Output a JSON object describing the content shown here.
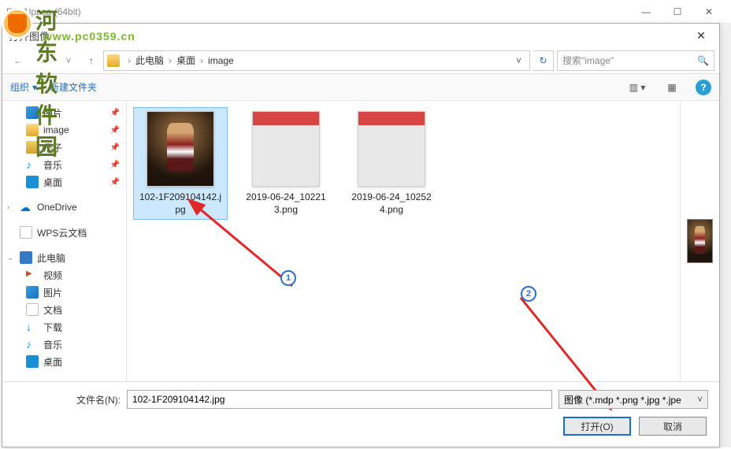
{
  "app": {
    "title": "FireAlpaca (64bit)"
  },
  "watermark": {
    "text1": "河东软件园",
    "text2": "www.pc0359.cn"
  },
  "dialog": {
    "title": "打开图像"
  },
  "breadcrumb": {
    "root": "此电脑",
    "mid": "桌面",
    "leaf": "image"
  },
  "search": {
    "placeholder": "搜索\"image\""
  },
  "toolbar": {
    "organize": "组织",
    "newfolder": "新建文件夹"
  },
  "sidebar": {
    "items": [
      {
        "label": "图片",
        "icon": "ico-pic",
        "pin": true
      },
      {
        "label": "image",
        "icon": "ico-folder",
        "pin": true
      },
      {
        "label": "尺子",
        "icon": "ico-ruler",
        "pin": true
      },
      {
        "label": "音乐",
        "icon": "ico-music",
        "pin": true
      },
      {
        "label": "桌面",
        "icon": "ico-desktop",
        "pin": true
      },
      {
        "label": "OneDrive",
        "icon": "ico-cloud",
        "header": true
      },
      {
        "label": "WPS云文档",
        "icon": "ico-doc",
        "header": true
      },
      {
        "label": "此电脑",
        "icon": "ico-pc",
        "header": true
      },
      {
        "label": "视频",
        "icon": "ico-video"
      },
      {
        "label": "图片",
        "icon": "ico-pic"
      },
      {
        "label": "文档",
        "icon": "ico-doc"
      },
      {
        "label": "下载",
        "icon": "ico-dl"
      },
      {
        "label": "音乐",
        "icon": "ico-music"
      },
      {
        "label": "桌面",
        "icon": "ico-desktop"
      }
    ]
  },
  "files": [
    {
      "name": "102-1F209104142.jpg",
      "selected": true,
      "thumb": "dark-img"
    },
    {
      "name": "2019-06-24_102213.png",
      "selected": false,
      "thumb": "screenshot"
    },
    {
      "name": "2019-06-24_102524.png",
      "selected": false,
      "thumb": "screenshot"
    }
  ],
  "steps": {
    "one": "1",
    "two": "2"
  },
  "footer": {
    "filename_label": "文件名(N):",
    "filename_value": "102-1F209104142.jpg",
    "filter": "图像 (*.mdp *.png *.jpg *.jpe",
    "open": "打开(O)",
    "cancel": "取消"
  }
}
